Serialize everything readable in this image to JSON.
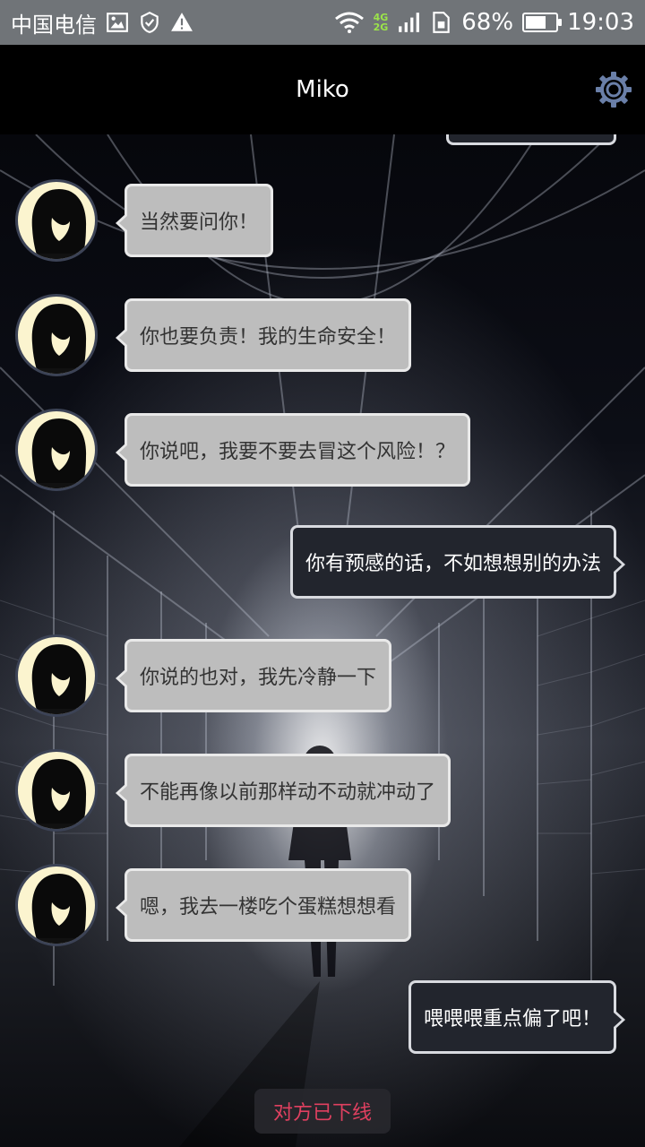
{
  "status_bar": {
    "carrier": "中国电信",
    "network": "4G",
    "network_secondary": "2G",
    "battery": "68%",
    "battery_level": 0.68,
    "time": "19:03",
    "icons": [
      "image-icon",
      "vpn-shield-icon",
      "warning-icon",
      "wifi-icon",
      "signal-icon",
      "sim-icon",
      "battery-icon"
    ]
  },
  "header": {
    "title": "Miko",
    "settings_icon": "gear-icon",
    "accent_color": "#6a7fa8"
  },
  "messages": [
    {
      "side": "in",
      "text": "当然要问你！"
    },
    {
      "side": "in",
      "text": "你也要负责！我的生命安全！"
    },
    {
      "side": "in",
      "text": "你说吧，我要不要去冒这个风险！？"
    },
    {
      "side": "out",
      "text": "你有预感的话，不如想想别的办法"
    },
    {
      "side": "in",
      "text": "你说的也对，我先冷静一下"
    },
    {
      "side": "in",
      "text": "不能再像以前那样动不动就冲动了"
    },
    {
      "side": "in",
      "text": "嗯，我去一楼吃个蛋糕想想看"
    },
    {
      "side": "out",
      "text": "喂喂喂重点偏了吧！"
    }
  ],
  "status_notice": {
    "text": "对方已下线",
    "color": "#e04060"
  }
}
